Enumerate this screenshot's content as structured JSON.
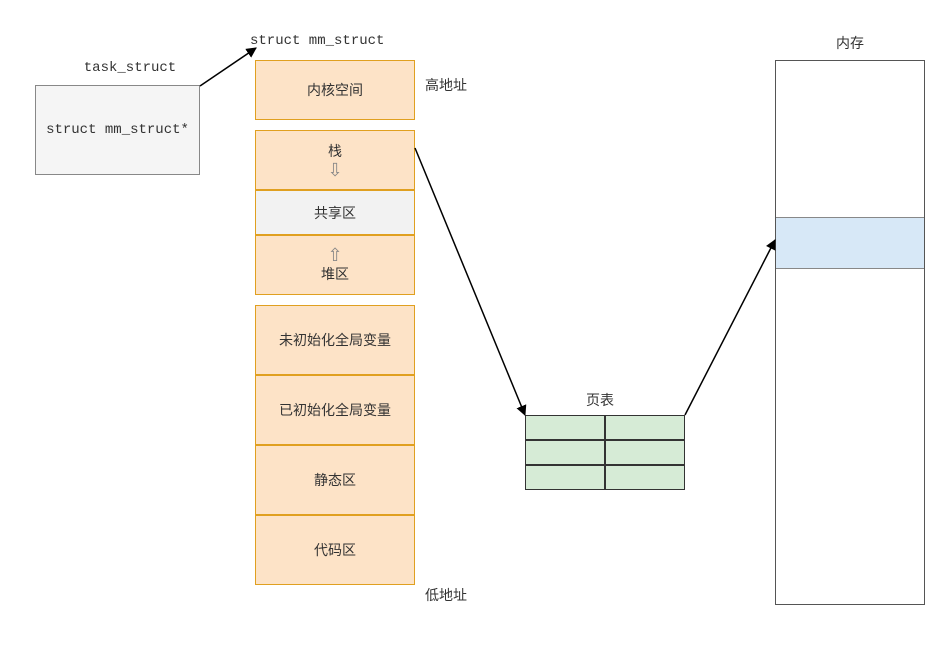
{
  "task_struct": {
    "title": "task_struct",
    "pointer_field": "struct mm_struct*"
  },
  "mm_struct": {
    "title": "struct mm_struct",
    "high_addr_label": "高地址",
    "low_addr_label": "低地址",
    "regions": {
      "kernel_space": "内核空间",
      "stack": "栈",
      "shared": "共享区",
      "heap": "堆区",
      "bss": "未初始化全局变量",
      "data": "已初始化全局变量",
      "static": "静态区",
      "code": "代码区"
    }
  },
  "page_table": {
    "title": "页表"
  },
  "memory": {
    "title": "内存"
  },
  "icons": {
    "down_arrow": "⇩",
    "up_arrow": "⇧"
  },
  "colors": {
    "mm_cell_bg": "#fde3c7",
    "mm_cell_border": "#e0a020",
    "task_bg": "#f5f5f5",
    "page_table_bg": "#d6ebd6",
    "memory_band_bg": "#d7e8f7"
  }
}
